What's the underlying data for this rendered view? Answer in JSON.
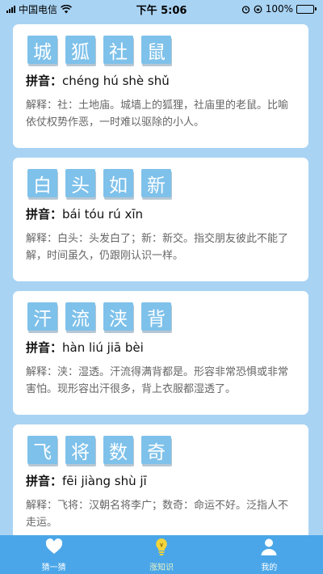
{
  "status": {
    "carrier": "中国电信",
    "time": "下午 5:06",
    "battery": "100%"
  },
  "idioms": [
    {
      "chars": [
        "城",
        "狐",
        "社",
        "鼠"
      ],
      "pinyin_label": "拼音：",
      "pinyin": "chéng hú shè shǔ",
      "desc": "解释：社：土地庙。城墙上的狐狸，社庙里的老鼠。比喻依仗权势作恶，一时难以驱除的小人。"
    },
    {
      "chars": [
        "白",
        "头",
        "如",
        "新"
      ],
      "pinyin_label": "拼音：",
      "pinyin": "bái tóu rú xīn",
      "desc": "解释：白头：头发白了；新：新交。指交朋友彼此不能了解，时间虽久，仍跟刚认识一样。"
    },
    {
      "chars": [
        "汗",
        "流",
        "浃",
        "背"
      ],
      "pinyin_label": "拼音：",
      "pinyin": "hàn liú jiā bèi",
      "desc": "解释：浃：湿透。汗流得满背都是。形容非常恐惧或非常害怕。现形容出汗很多，背上衣服都湿透了。"
    },
    {
      "chars": [
        "飞",
        "将",
        "数",
        "奇"
      ],
      "pinyin_label": "拼音：",
      "pinyin": "fēi jiàng shù jī",
      "desc": "解释：飞将：汉朝名将李广；数奇：命运不好。泛指人不走运。"
    }
  ],
  "tabs": [
    {
      "label": "猜一猜",
      "icon": "heart-icon"
    },
    {
      "label": "涨知识",
      "icon": "lightbulb-icon"
    },
    {
      "label": "我的",
      "icon": "person-icon"
    }
  ],
  "colors": {
    "background": "#a9d3f3",
    "tile": "#7ec1ea",
    "tabbar": "#4aa6e8",
    "bulb": "#f2d43a"
  },
  "battery_level": 1.0
}
